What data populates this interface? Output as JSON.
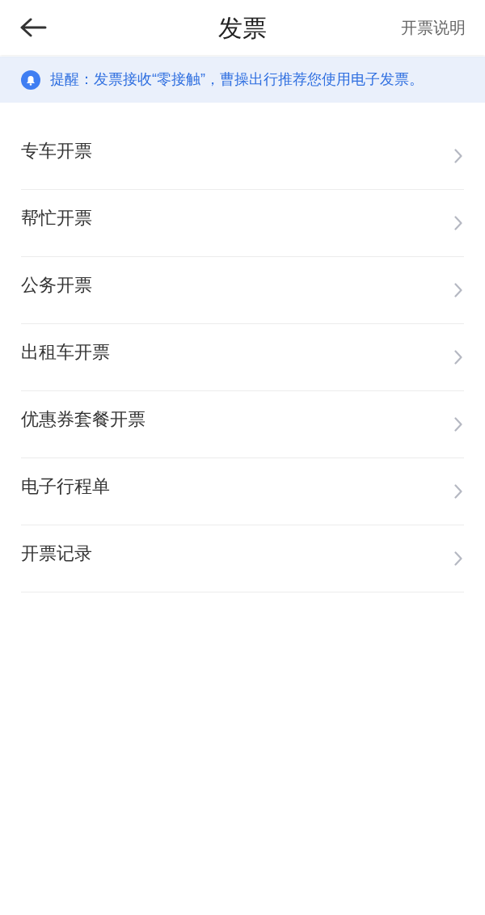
{
  "header": {
    "title": "发票",
    "action": "开票说明"
  },
  "notice": {
    "text": "提醒：发票接收“零接触”，曹操出行推荐您使用电子发票。"
  },
  "menu": [
    {
      "label": "专车开票"
    },
    {
      "label": "帮忙开票"
    },
    {
      "label": "公务开票"
    },
    {
      "label": "出租车开票"
    },
    {
      "label": "优惠券套餐开票"
    },
    {
      "label": "电子行程单"
    },
    {
      "label": "开票记录"
    }
  ]
}
